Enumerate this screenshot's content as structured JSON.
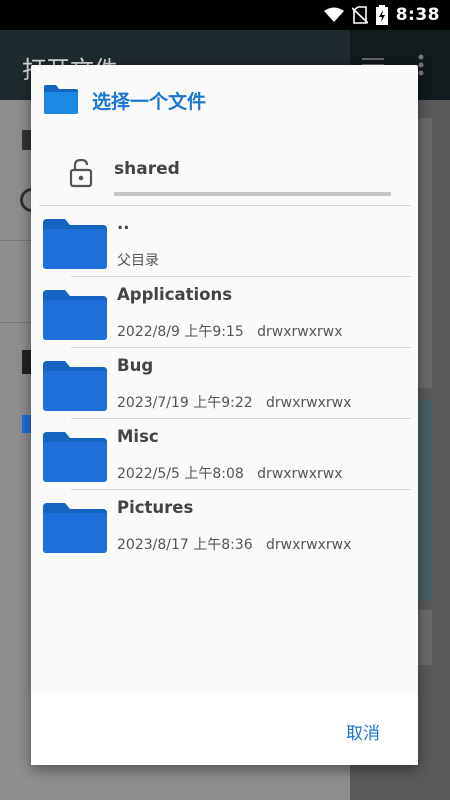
{
  "status_bar": {
    "time": "8:38"
  },
  "background_app": {
    "title": "打开文件"
  },
  "dialog": {
    "title": "选择一个文件",
    "current_path": "shared",
    "items": [
      {
        "name": "..",
        "meta": "父目录"
      },
      {
        "name": "Applications",
        "meta": "2022/8/9 上午9:15   drwxrwxrwx"
      },
      {
        "name": "Bug",
        "meta": "2023/7/19 上午9:22   drwxrwxrwx"
      },
      {
        "name": "Misc",
        "meta": "2022/5/5 上午8:08   drwxrwxrwx"
      },
      {
        "name": "Pictures",
        "meta": "2023/8/17 上午8:36   drwxrwxrwx"
      }
    ],
    "cancel_label": "取消"
  },
  "colors": {
    "accent": "#1976d2",
    "folder": "#1e6fd9",
    "folder_tab": "#1565c0"
  }
}
